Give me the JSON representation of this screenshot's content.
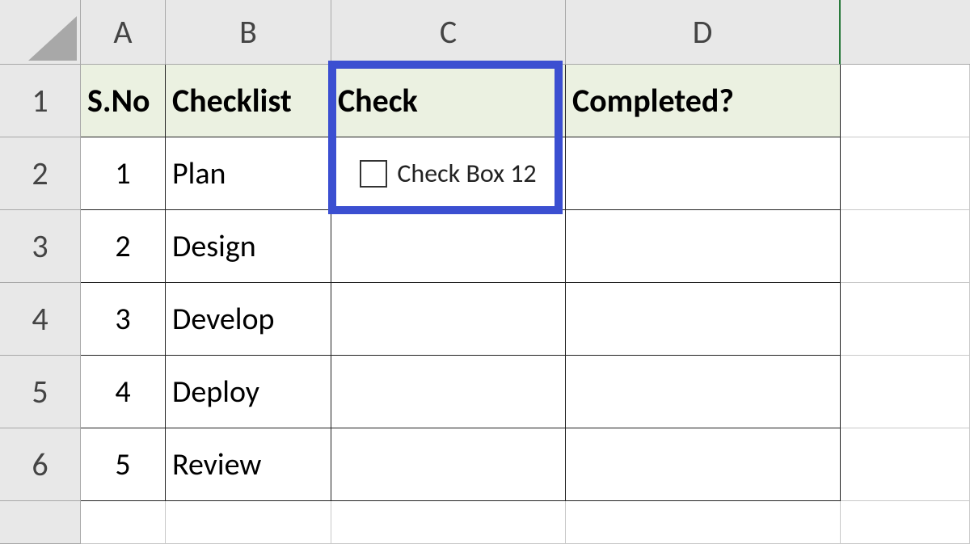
{
  "columns": [
    "A",
    "B",
    "C",
    "D"
  ],
  "rows": [
    "1",
    "2",
    "3",
    "4",
    "5",
    "6"
  ],
  "header": {
    "A": "S.No",
    "B": "Checklist",
    "C": "Check",
    "D": "Completed?"
  },
  "data": [
    {
      "sno": "1",
      "checklist": "Plan"
    },
    {
      "sno": "2",
      "checklist": "Design"
    },
    {
      "sno": "3",
      "checklist": "Develop"
    },
    {
      "sno": "4",
      "checklist": "Deploy"
    },
    {
      "sno": "5",
      "checklist": "Review"
    }
  ],
  "checkbox": {
    "label": "Check Box 12",
    "checked": false
  },
  "highlight": {
    "col": "C",
    "rows": "1-2"
  }
}
